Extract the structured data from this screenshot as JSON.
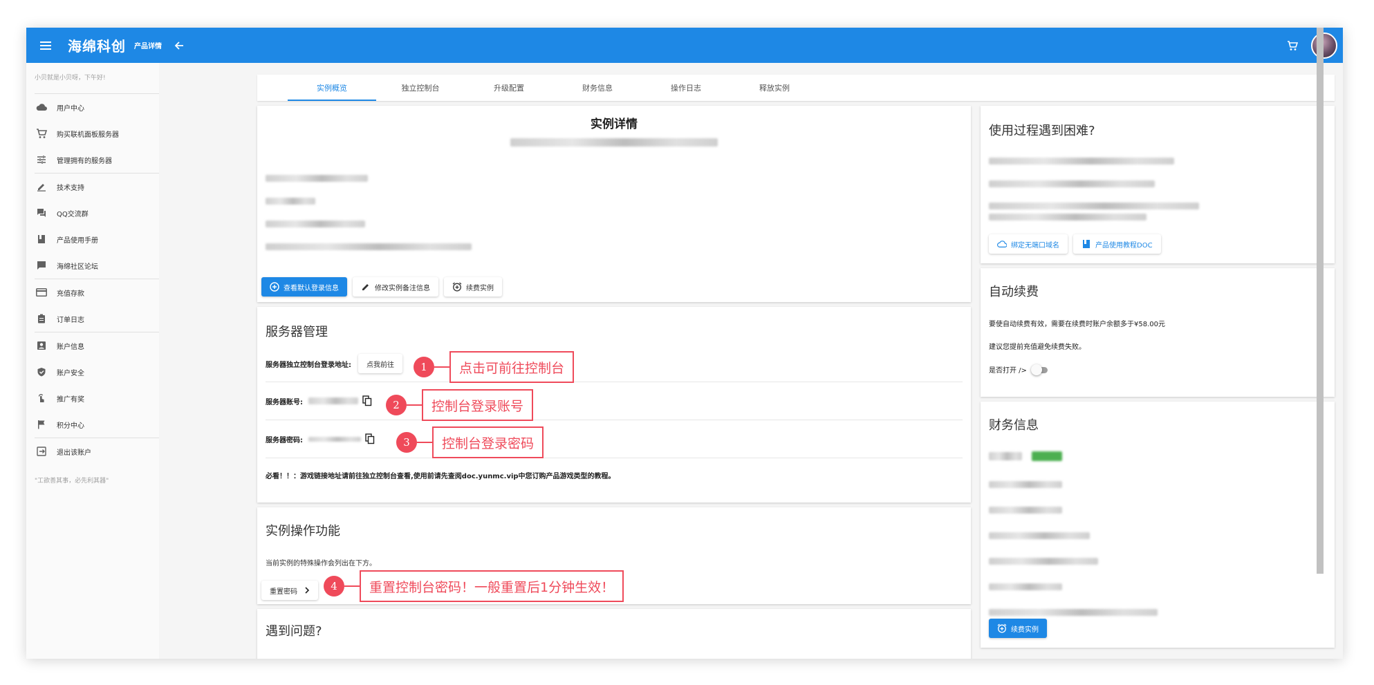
{
  "appbar": {
    "brand": "海绵科创",
    "subtitle": "产品详情"
  },
  "sidebar": {
    "greeting": "小贝就是小贝呀，下午好!",
    "groups": [
      [
        {
          "label": "用户中心",
          "icon": "cloud-icon"
        },
        {
          "label": "购买联机面板服务器",
          "icon": "cart-icon"
        },
        {
          "label": "管理拥有的服务器",
          "icon": "tune-icon"
        }
      ],
      [
        {
          "label": "技术支持",
          "icon": "pencil-icon"
        },
        {
          "label": "QQ交流群",
          "icon": "forum-icon"
        },
        {
          "label": "产品使用手册",
          "icon": "book-icon"
        },
        {
          "label": "海绵社区论坛",
          "icon": "chat-icon"
        }
      ],
      [
        {
          "label": "充值存款",
          "icon": "credit-card-icon"
        },
        {
          "label": "订单日志",
          "icon": "clipboard-icon"
        }
      ],
      [
        {
          "label": "账户信息",
          "icon": "account-box-icon"
        },
        {
          "label": "账户安全",
          "icon": "shield-check-icon"
        },
        {
          "label": "推广有奖",
          "icon": "touch-icon"
        },
        {
          "label": "积分中心",
          "icon": "flag-icon"
        }
      ],
      [
        {
          "label": "退出该账户",
          "icon": "logout-icon"
        }
      ]
    ],
    "quote": "\"工欲善其事，必先利其器\""
  },
  "tabs": [
    "实例概览",
    "独立控制台",
    "升级配置",
    "财务信息",
    "操作日志",
    "释放实例"
  ],
  "instance_card": {
    "title": "实例详情",
    "btn_view_login": "查看默认登录信息",
    "btn_edit_note": "修改实例备注信息",
    "btn_renew": "续费实例"
  },
  "server_card": {
    "title": "服务器管理",
    "console_label": "服务器独立控制台登录地址:",
    "console_button": "点我前往",
    "account_label": "服务器账号:",
    "password_label": "服务器密码:",
    "notice": "必看！！：游戏链接地址请前往独立控制台查看,使用前请先查阅doc.yunmc.vip中您订购产品游戏类型的教程。"
  },
  "ops_card": {
    "title": "实例操作功能",
    "desc": "当前实例的特殊操作会列出在下方。",
    "reset_button": "重置密码"
  },
  "problem_card": {
    "title": "遇到问题?"
  },
  "help_card": {
    "title": "使用过程遇到困难?",
    "btn_bind": "绑定无端口域名",
    "btn_doc": "产品使用教程DOC"
  },
  "renew_card": {
    "title": "自动续费",
    "line1": "要使自动续费有效，需要在续费时账户余额多于¥58.00元",
    "line2": "建议您提前充值避免续费失败。",
    "toggle_label": "是否打开 />"
  },
  "finance_card": {
    "title": "财务信息",
    "renew_button": "续费实例"
  },
  "annotations": [
    {
      "num": "1",
      "text": "点击可前往控制台"
    },
    {
      "num": "2",
      "text": "控制台登录账号"
    },
    {
      "num": "3",
      "text": "控制台登录密码"
    },
    {
      "num": "4",
      "text": "重置控制台密码！一般重置后1分钟生效！"
    }
  ],
  "colors": {
    "primary": "#1e88e5",
    "annotation": "#ef4a5a",
    "success": "#4caf50"
  }
}
